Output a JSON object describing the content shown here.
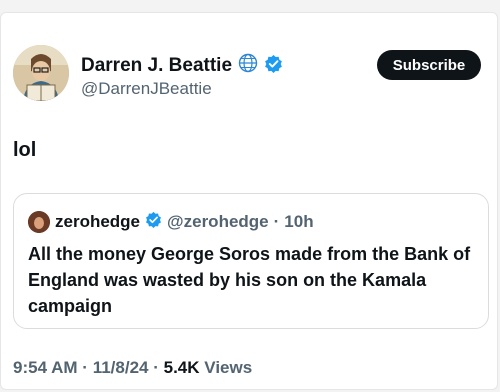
{
  "author": {
    "display_name": "Darren J. Beattie",
    "handle": "@DarrenJBeattie",
    "affiliation_icon": "globe-icon",
    "verified_icon": "verified-badge-icon"
  },
  "subscribe_label": "Subscribe",
  "tweet_text": "lol",
  "quoted": {
    "display_name": "zerohedge",
    "handle": "@zerohedge",
    "separator": "·",
    "time": "10h",
    "text": "All the money George Soros made from the Bank of England was wasted by his son on the Kamala campaign"
  },
  "footer": {
    "time": "9:54 AM",
    "sep1": "·",
    "date": "11/8/24",
    "sep2": "·",
    "views_count": "5.4K",
    "views_label": "Views"
  },
  "colors": {
    "verified": "#1d9bf0",
    "text": "#0f1419",
    "muted": "#536471"
  }
}
